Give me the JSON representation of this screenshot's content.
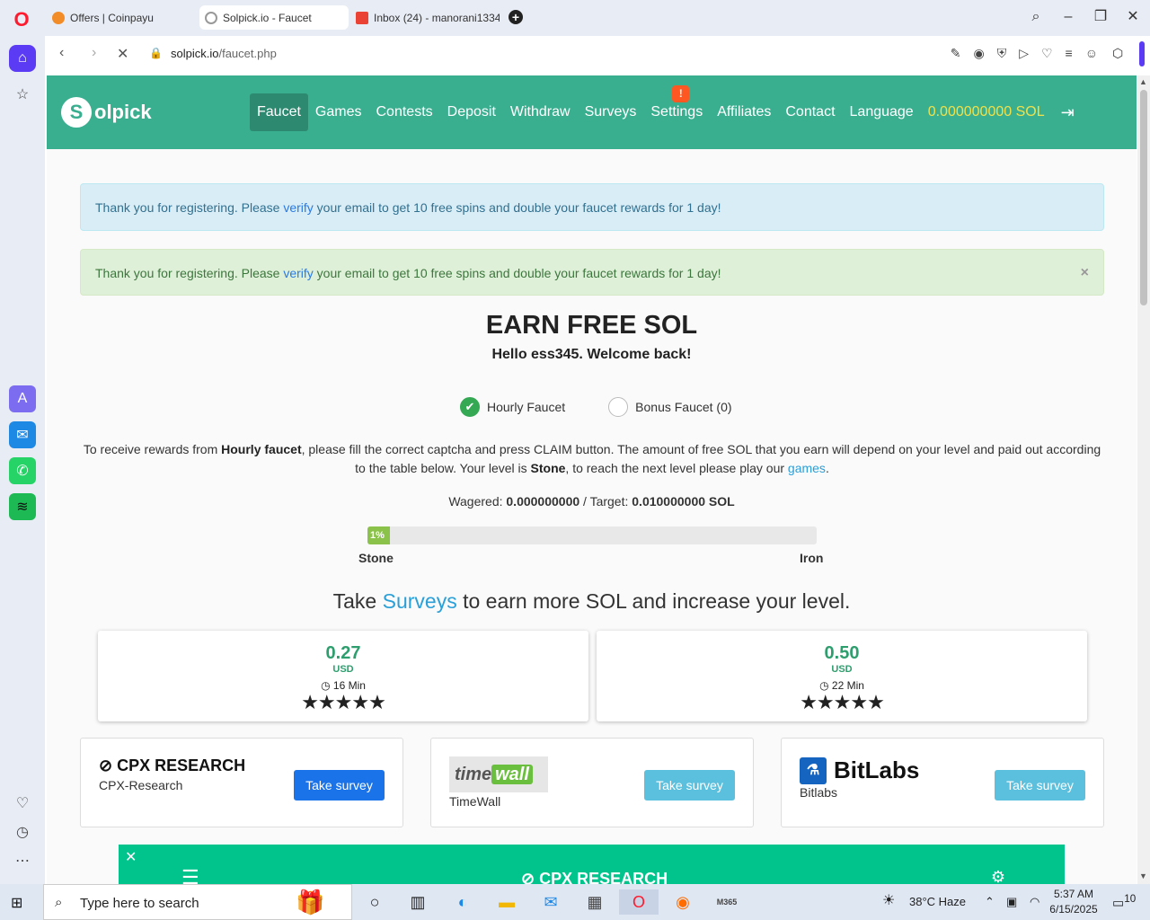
{
  "browser": {
    "tabs": [
      {
        "title": "Offers | Coinpayu",
        "active": false
      },
      {
        "title": "Solpick.io - Faucet",
        "active": true
      },
      {
        "title": "Inbox (24) - manorani1334",
        "active": false
      }
    ],
    "url_host": "solpick.io",
    "url_path": "/faucet.php"
  },
  "site": {
    "logo_mark": "S",
    "logo_text": "olpick",
    "menu": [
      "Faucet",
      "Games",
      "Contests",
      "Deposit",
      "Withdraw",
      "Surveys",
      "Settings",
      "Affiliates",
      "Contact",
      "Language"
    ],
    "settings_badge": "!",
    "balance": "0.000000000 SOL"
  },
  "alerts": {
    "info": {
      "before": "Thank you for registering. Please ",
      "link": "verify",
      "after": " your email to get 10 free spins and double your faucet rewards for 1 day!"
    },
    "success": {
      "before": "Thank you for registering. Please ",
      "link": "verify",
      "after": " your email to get 10 free spins and double your faucet rewards for 1 day!",
      "close": "×"
    }
  },
  "main": {
    "title": "EARN FREE SOL",
    "greeting": "Hello ess345. Welcome back!",
    "radio_hourly": "Hourly Faucet",
    "radio_bonus": "Bonus Faucet (0)",
    "desc_1": "To receive rewards from ",
    "desc_bold1": "Hourly faucet",
    "desc_2": ", please fill the correct captcha and press CLAIM button. The amount of free SOL that you earn will depend on your level and paid out according to the table below. Your level is ",
    "desc_bold2": "Stone",
    "desc_3": ", to reach the next level please play our ",
    "desc_link": "games",
    "desc_4": ".",
    "wager_label": "Wagered: ",
    "wager_value": "0.000000000",
    "target_label": " / Target: ",
    "target_value": "0.010000000 SOL",
    "progress_label": "1%",
    "progress_fraction": 0.01,
    "level_current": "Stone",
    "level_next": "Iron",
    "surveys_before": "Take ",
    "surveys_link": "Surveys",
    "surveys_after": " to earn more SOL and increase your level."
  },
  "offers": [
    {
      "amount": "0.27",
      "currency": "USD",
      "time": "16 Min",
      "stars": "★★★★★"
    },
    {
      "amount": "0.50",
      "currency": "USD",
      "time": "22 Min",
      "stars": "★★★★★"
    }
  ],
  "providers": [
    {
      "logo": "CPX RESEARCH",
      "name": "CPX-Research",
      "button": "Take survey"
    },
    {
      "logo_a": "time",
      "logo_b": "wall",
      "name": "TimeWall",
      "button": "Take survey"
    },
    {
      "logo": "BitLabs",
      "name": "Bitlabs",
      "button": "Take survey"
    }
  ],
  "ad": {
    "brand": "CPX RESEARCH"
  },
  "taskbar": {
    "search_placeholder": "Type here to search",
    "weather": "38°C  Haze",
    "time": "5:37 AM",
    "date": "6/15/2025",
    "notifications": "10",
    "m365_label": "M365"
  }
}
